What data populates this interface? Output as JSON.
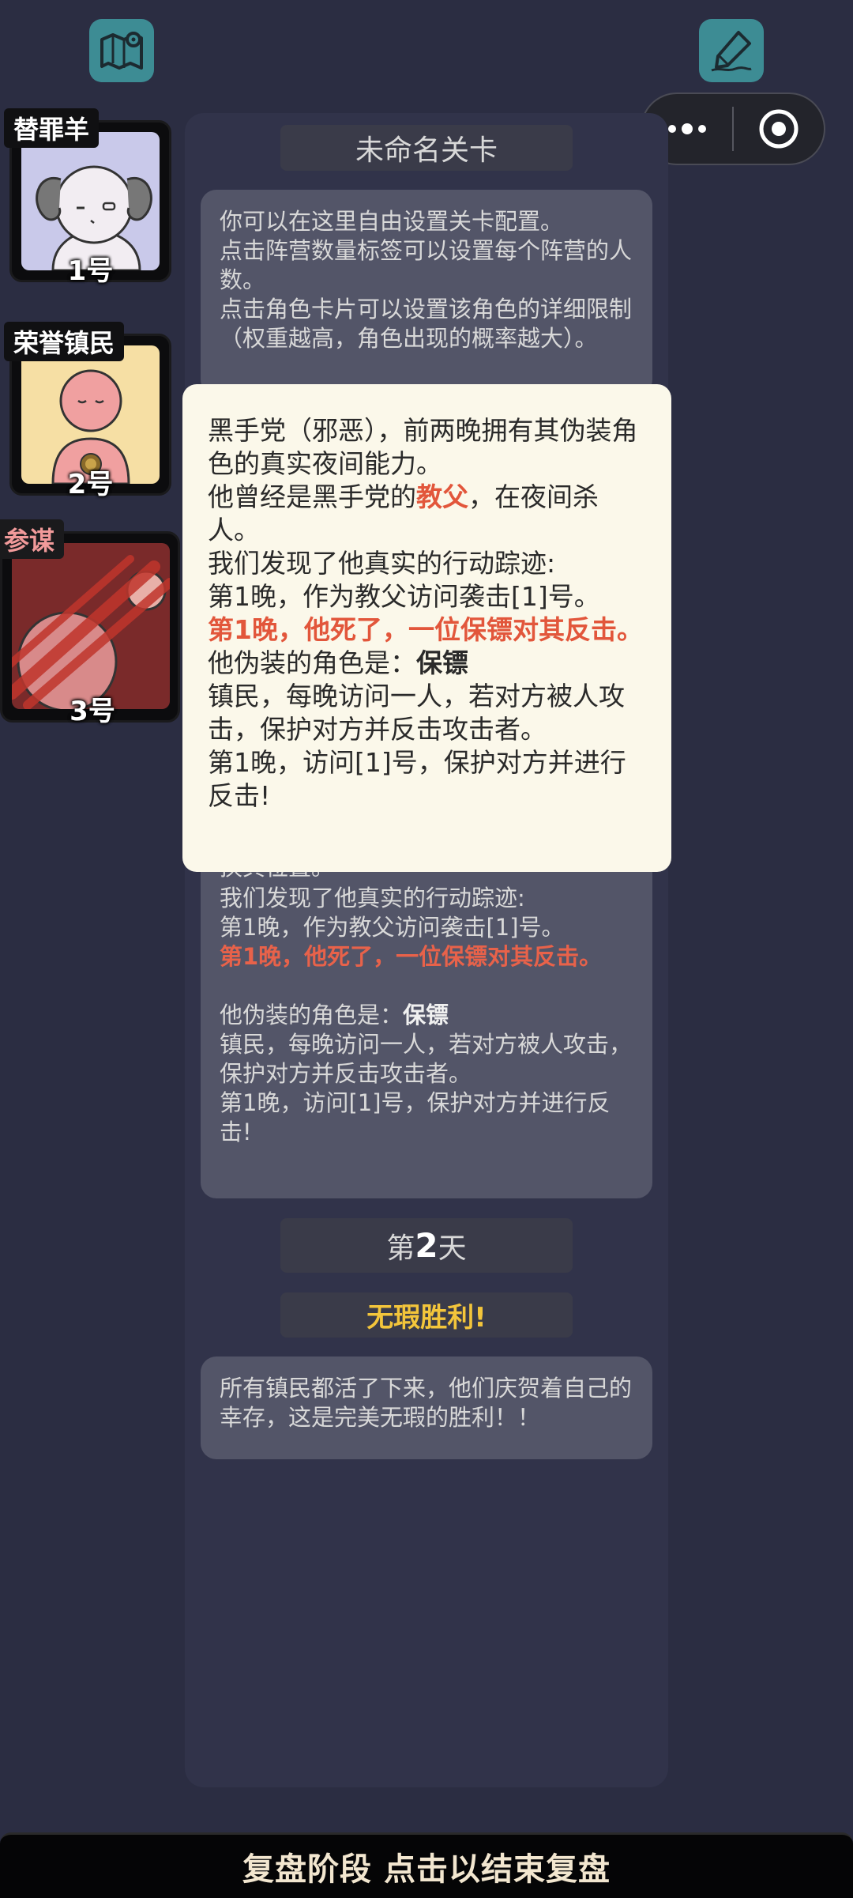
{
  "top": {
    "map_icon": "map-icon",
    "edit_icon": "edit-pen-icon",
    "capsule": {
      "more_icon": "more-dots-icon",
      "close_icon": "target-circle-icon"
    }
  },
  "level": {
    "title": "未命名关卡",
    "intro": [
      "你可以在这里自由设置关卡配置。",
      "点击阵营数量标签可以设置每个阵营的人数。",
      "点击角色卡片可以设置该角色的详细限制（权重越高，角色出现的概率越大）。"
    ]
  },
  "players": [
    {
      "role": "替罪羊",
      "number": "1号",
      "color": "#c9c9ea"
    },
    {
      "role": "荣誉镇民",
      "number": "2号",
      "color": "#f6dfa4"
    },
    {
      "role": "参谋",
      "number": "3号",
      "color": "#7a2a2a",
      "dead": true
    }
  ],
  "night_log": {
    "partial_line": "换其位置。",
    "trace": "我们发现了他真实的行动踪迹:",
    "action": "第1晚，作为教父访问袭击[1]号。",
    "death": "第1晚，他死了，一位保镖对其反击。",
    "disguise_prefix": "他伪装的角色是：",
    "disguise_role": "保镖",
    "disguise_desc": "镇民，每晚访问一人，若对方被人攻击，保护对方并反击攻击者。",
    "disguise_action": "第1晚，访问[1]号，保护对方并进行反击!"
  },
  "day": {
    "prefix": "第",
    "num": "2",
    "suffix": "天"
  },
  "result": {
    "title": "无瑕胜利!",
    "text": "所有镇民都活了下来，他们庆贺着自己的幸存，这是完美无瑕的胜利！！"
  },
  "popup": {
    "line1": "黑手党（邪恶），前两晚拥有其伪装角色的真实夜间能力。",
    "line2_prefix": "他曾经是黑手党的",
    "line2_role": "教父",
    "line2_suffix": "，在夜间杀人。",
    "trace": "我们发现了他真实的行动踪迹:",
    "action": "第1晚，作为教父访问袭击[1]号。",
    "death": "第1晚，他死了，一位保镖对其反击。",
    "disguise_prefix": "他伪装的角色是：",
    "disguise_role": "保镖",
    "disguise_desc": "镇民，每晚访问一人，若对方被人攻击，保护对方并反击攻击者。",
    "disguise_action": "第1晚，访问[1]号，保护对方并进行反击!"
  },
  "bottom_bar": {
    "label": "复盘阶段 点击以结束复盘"
  }
}
